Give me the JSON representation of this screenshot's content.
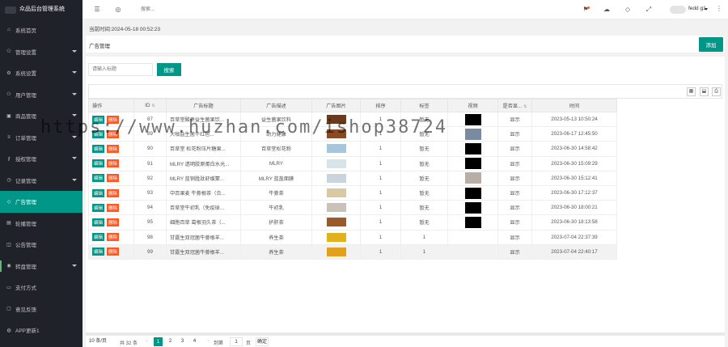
{
  "app": {
    "title": "众品后台管理系统"
  },
  "sidebar": {
    "items": [
      {
        "label": "系统首页",
        "icon": "home-icon",
        "has_arrow": false
      },
      {
        "label": "管理设置",
        "icon": "user-icon",
        "has_arrow": true
      },
      {
        "label": "系统设置",
        "icon": "gear-icon",
        "has_arrow": true
      },
      {
        "label": "用户管理",
        "icon": "user-icon",
        "has_arrow": true
      },
      {
        "label": "商品管理",
        "icon": "cart-icon",
        "has_arrow": true
      },
      {
        "label": "订单管理",
        "icon": "list-icon",
        "has_arrow": true
      },
      {
        "label": "授权管理",
        "icon": "key-icon",
        "has_arrow": true
      },
      {
        "label": "记录管理",
        "icon": "clock-icon",
        "has_arrow": true
      },
      {
        "label": "广告管理",
        "icon": "tag-icon",
        "has_arrow": false,
        "active": true
      },
      {
        "label": "轮播管理",
        "icon": "image-icon",
        "has_arrow": false
      },
      {
        "label": "公告管理",
        "icon": "notice-icon",
        "has_arrow": false
      },
      {
        "label": "转盘管理",
        "icon": "wheel-icon",
        "has_arrow": true
      },
      {
        "label": "支付方式",
        "icon": "pay-icon",
        "has_arrow": false
      },
      {
        "label": "意见反馈",
        "icon": "chat-icon",
        "has_arrow": false
      },
      {
        "label": "APP更新1",
        "icon": "app-icon",
        "has_arrow": false
      }
    ]
  },
  "topbar": {
    "search_placeholder": "搜索...",
    "username": "fedd g1"
  },
  "timebar": {
    "text": "当前时间:2024-05-18 00:52:23"
  },
  "panel": {
    "title": "广告管理",
    "add_label": "添加"
  },
  "filter": {
    "placeholder": "请输入标题",
    "search_label": "搜索"
  },
  "table": {
    "headers": [
      "操作",
      "ID",
      "广告标题",
      "广告描述",
      "广告图片",
      "排序",
      "标签",
      "视频",
      "是否显...",
      "时间"
    ],
    "edit_label": "编辑",
    "delete_label": "删除",
    "rows": [
      {
        "id": "87",
        "title": "百草堂酸枣益生菌果饮...",
        "desc": "益生菌果饮料",
        "thumb": "#6b3a1c",
        "sort": "1",
        "tag": "暂无",
        "video": "#000000",
        "show": "显示",
        "time": "2023-05-13 10:50:24"
      },
      {
        "id": "89",
        "title": "大咖益生菌干红色...",
        "desc": "助力健康",
        "thumb": "#8a4b24",
        "sort": "1",
        "tag": "暂无",
        "video": "#7a8aa0",
        "show": "显示",
        "time": "2023-06-17 12:45:50"
      },
      {
        "id": "90",
        "title": "百草堂 松花粉压片糖果...",
        "desc": "百草堂松花粉",
        "thumb": "#a7c6d9",
        "sort": "1",
        "tag": "暂无",
        "video": "#000000",
        "show": "显示",
        "time": "2023-06-30 14:58:42"
      },
      {
        "id": "91",
        "title": "MLRY 透明胶原蛋白水光...",
        "desc": "MLRY",
        "thumb": "#d9e3ea",
        "sort": "1",
        "tag": "暂无",
        "video": "#000000",
        "show": "显示",
        "time": "2023-06-30 15:09:29"
      },
      {
        "id": "92",
        "title": "MLRY 蓝铜胜肽舒缓蒙...",
        "desc": "MLRY 蓝盖面膜",
        "thumb": "#c9d4dc",
        "sort": "1",
        "tag": "暂无",
        "video": "#b8aea6",
        "show": "显示",
        "time": "2023-06-30 15:12:41"
      },
      {
        "id": "93",
        "title": "中百果麦 牛蒡根茶（合...",
        "desc": "牛蒡茶",
        "thumb": "#d8c9a0",
        "sort": "1",
        "tag": "暂无",
        "video": "#000000",
        "show": "显示",
        "time": "2023-06-30 17:12:37"
      },
      {
        "id": "94",
        "title": "百草堂牛初乳（免疫球...",
        "desc": "牛初乳",
        "thumb": "#c8c2b8",
        "sort": "1",
        "tag": "暂无",
        "video": "#000000",
        "show": "显示",
        "time": "2023-06-30 18:00:21"
      },
      {
        "id": "95",
        "title": "细胞百草 葛根羽久茶（...",
        "desc": "护肝茶",
        "thumb": "#9a5a2a",
        "sort": "1",
        "tag": "暂无",
        "video": "#000000",
        "show": "显示",
        "time": "2023-06-30 18:13:58"
      },
      {
        "id": "98",
        "title": "甘露生双冠菌牛蒡根羊...",
        "desc": "养生茶",
        "thumb": "#e2b21c",
        "sort": "1",
        "tag": "1",
        "video": "",
        "show": "显示",
        "time": "2023-07-04 22:37:39"
      },
      {
        "id": "99",
        "title": "甘露生双冠菌牛蒡根羊...",
        "desc": "养生茶",
        "thumb": "#e2a01c",
        "sort": "1",
        "tag": "1",
        "video": "",
        "show": "显示",
        "time": "2023-07-04 22:40:17"
      }
    ]
  },
  "pager": {
    "page_size": "10 条/页",
    "total": "共 32 条",
    "pages": [
      "1",
      "2",
      "3",
      "4"
    ],
    "current": "1",
    "goto_label": "到第",
    "goto_value": "1",
    "page_unit": "页",
    "confirm_label": "确定",
    "prev": "‹",
    "next": "›"
  },
  "watermark": {
    "text": "https://www.huzhan.com/ishop38724"
  },
  "colors": {
    "primary": "#009688",
    "danger": "#ff5722",
    "sidebar_bg": "#20222a"
  }
}
